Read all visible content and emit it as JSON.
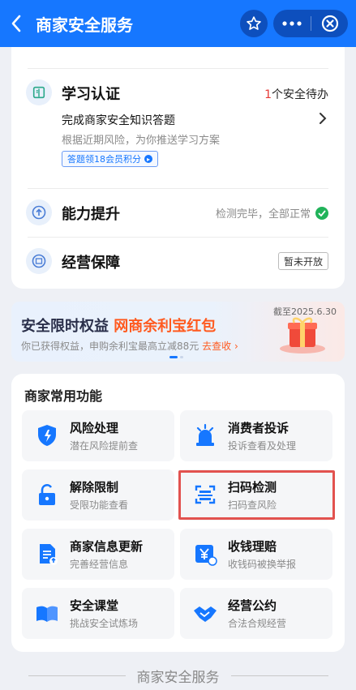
{
  "header": {
    "title": "商家安全服务"
  },
  "learn": {
    "title": "学习认证",
    "todo_count": "1",
    "todo_text": "个安全待办",
    "main": "完成商家安全知识答题",
    "sub": "根据近期风险，为你推送学习方案",
    "tag": "答题领18会员积分"
  },
  "ability": {
    "title": "能力提升",
    "status": "检测完毕，全部正常"
  },
  "guarantee": {
    "title": "经营保障",
    "badge": "暂未开放"
  },
  "banner": {
    "date": "截至2025.6.30",
    "title_a": "安全限时权益",
    "title_b": "网商余利宝红包",
    "sub": "你已获得权益，申购余利宝最高立减88元",
    "go": "去查收"
  },
  "functions": {
    "title": "商家常用功能",
    "items": [
      {
        "title": "风险处理",
        "sub": "潜在风险提前查",
        "icon": "shield-icon"
      },
      {
        "title": "消费者投诉",
        "sub": "投诉查看及处理",
        "icon": "alarm-icon"
      },
      {
        "title": "解除限制",
        "sub": "受限功能查看",
        "icon": "unlock-icon"
      },
      {
        "title": "扫码检测",
        "sub": "扫码查风险",
        "icon": "scan-icon"
      },
      {
        "title": "商家信息更新",
        "sub": "完善经营信息",
        "icon": "document-icon"
      },
      {
        "title": "收钱理赔",
        "sub": "收钱码被换举报",
        "icon": "yuan-claim-icon"
      },
      {
        "title": "安全课堂",
        "sub": "挑战安全试炼场",
        "icon": "book-icon"
      },
      {
        "title": "经营公约",
        "sub": "合法合规经营",
        "icon": "handshake-icon"
      }
    ]
  },
  "footer": {
    "text": "商家安全服务"
  },
  "colors": {
    "primary": "#1677ff",
    "accent": "#ff5a1f",
    "highlight": "#e2524f"
  }
}
